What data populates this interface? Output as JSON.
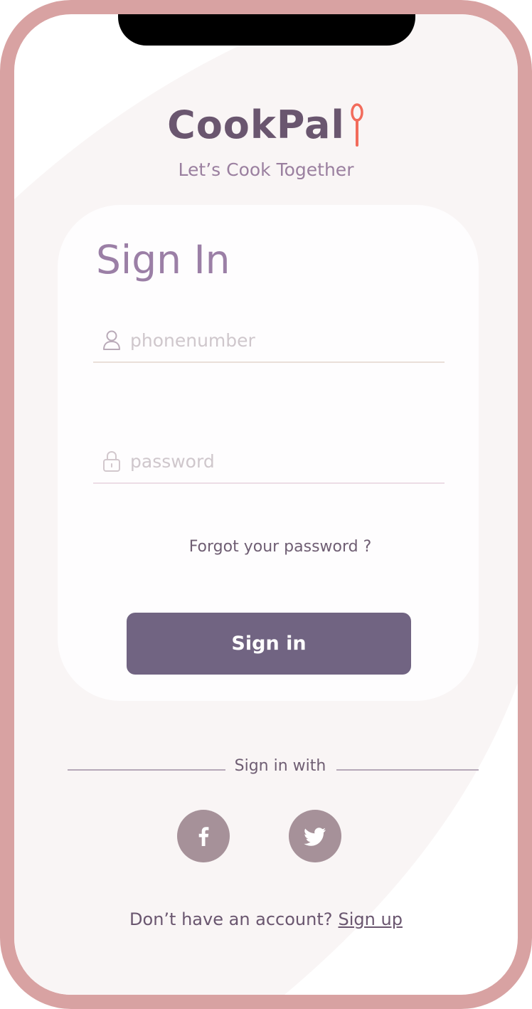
{
  "brand": {
    "name": "CookPal",
    "tagline": "Let’s Cook Together"
  },
  "signin": {
    "title": "Sign In",
    "phone_placeholder": "phonenumber",
    "password_placeholder": "password",
    "forgot_label": "Forgot your password ?",
    "button_label": "Sign in"
  },
  "social": {
    "label": "Sign in with",
    "providers": [
      "facebook-icon",
      "twitter-icon"
    ]
  },
  "footer": {
    "prompt": "Don’t have an account?",
    "signup_label": "Sign up"
  },
  "colors": {
    "frame": "#d8a2a2",
    "brand_text": "#6a566f",
    "accent": "#f26b5b",
    "button": "#716482",
    "social_button": "#a69199"
  }
}
